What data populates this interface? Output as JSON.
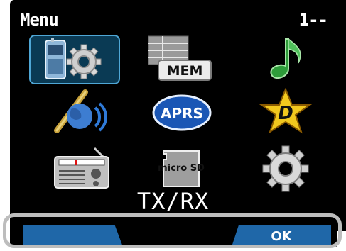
{
  "header": {
    "title": "Menu",
    "page_indicator": "1--"
  },
  "menu_items": [
    {
      "name": "configuration",
      "icon": "transceiver-gear-icon",
      "selected": true
    },
    {
      "name": "memory",
      "icon": "memory-table-icon",
      "badge": "MEM",
      "selected": false
    },
    {
      "name": "audio",
      "icon": "music-note-icon",
      "selected": false
    },
    {
      "name": "satellite",
      "icon": "satellite-globe-icon",
      "selected": false
    },
    {
      "name": "aprs",
      "icon": "aprs-badge-icon",
      "badge": "APRS",
      "selected": false
    },
    {
      "name": "dstar",
      "icon": "d-star-icon",
      "badge": "D",
      "selected": false
    },
    {
      "name": "radio",
      "icon": "radio-icon",
      "selected": false
    },
    {
      "name": "microsd",
      "icon": "microsd-card-icon",
      "badge": "micro SD",
      "selected": false
    },
    {
      "name": "settings",
      "icon": "gear-icon",
      "selected": false
    }
  ],
  "selected_label": "TX/RX",
  "softkeys": {
    "left": "",
    "right": "OK"
  },
  "colors": {
    "selection_bg": "#0a3a54",
    "selection_border": "#4fa7d6",
    "softkey": "#1f67a8",
    "note_green": "#2e9c3a",
    "star_yellow": "#f2c81e",
    "aprs_blue": "#1a56b5"
  }
}
